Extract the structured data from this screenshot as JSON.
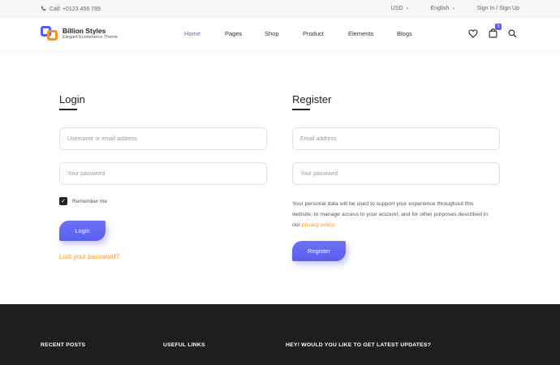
{
  "topbar": {
    "phone": "Call: +0123 456 789",
    "currency": "USD",
    "language": "English",
    "auth": "Sign In / Sign Up"
  },
  "brand": {
    "name": "Billion Styles",
    "tagline": "Elegant Ecommerce Theme",
    "accent": "#5a5ff0",
    "secondary": "#f7941d"
  },
  "nav": {
    "items": [
      "Home",
      "Pages",
      "Shop",
      "Product",
      "Elements",
      "Blogs"
    ]
  },
  "header_icons": {
    "wishlist": "heart-icon",
    "cart": "bag-icon",
    "cart_count": "3",
    "search": "search-icon"
  },
  "login": {
    "title": "Login",
    "username_placeholder": "Username or email address",
    "password_placeholder": "Your password",
    "remember_label": "Remember me",
    "remember_checked": true,
    "button": "Login",
    "lost_password": "Lost your password?"
  },
  "register": {
    "title": "Register",
    "email_placeholder": "Email address",
    "password_placeholder": "Your password",
    "policy_line1": "Your personal data will be used to support your experience throughout this",
    "policy_line2": "website, to manage access to your account, and for other purposes described in",
    "policy_prefix": "our",
    "policy_link": "privacy policy",
    "button": "Register"
  },
  "footer": {
    "recent_posts": "RECENT POSTS",
    "useful_links": "USEFUL LINKS",
    "newsletter": "HEY! WOULD YOU LIKE TO GET LATEST UPDATES?",
    "background": "#1e1e1e"
  }
}
